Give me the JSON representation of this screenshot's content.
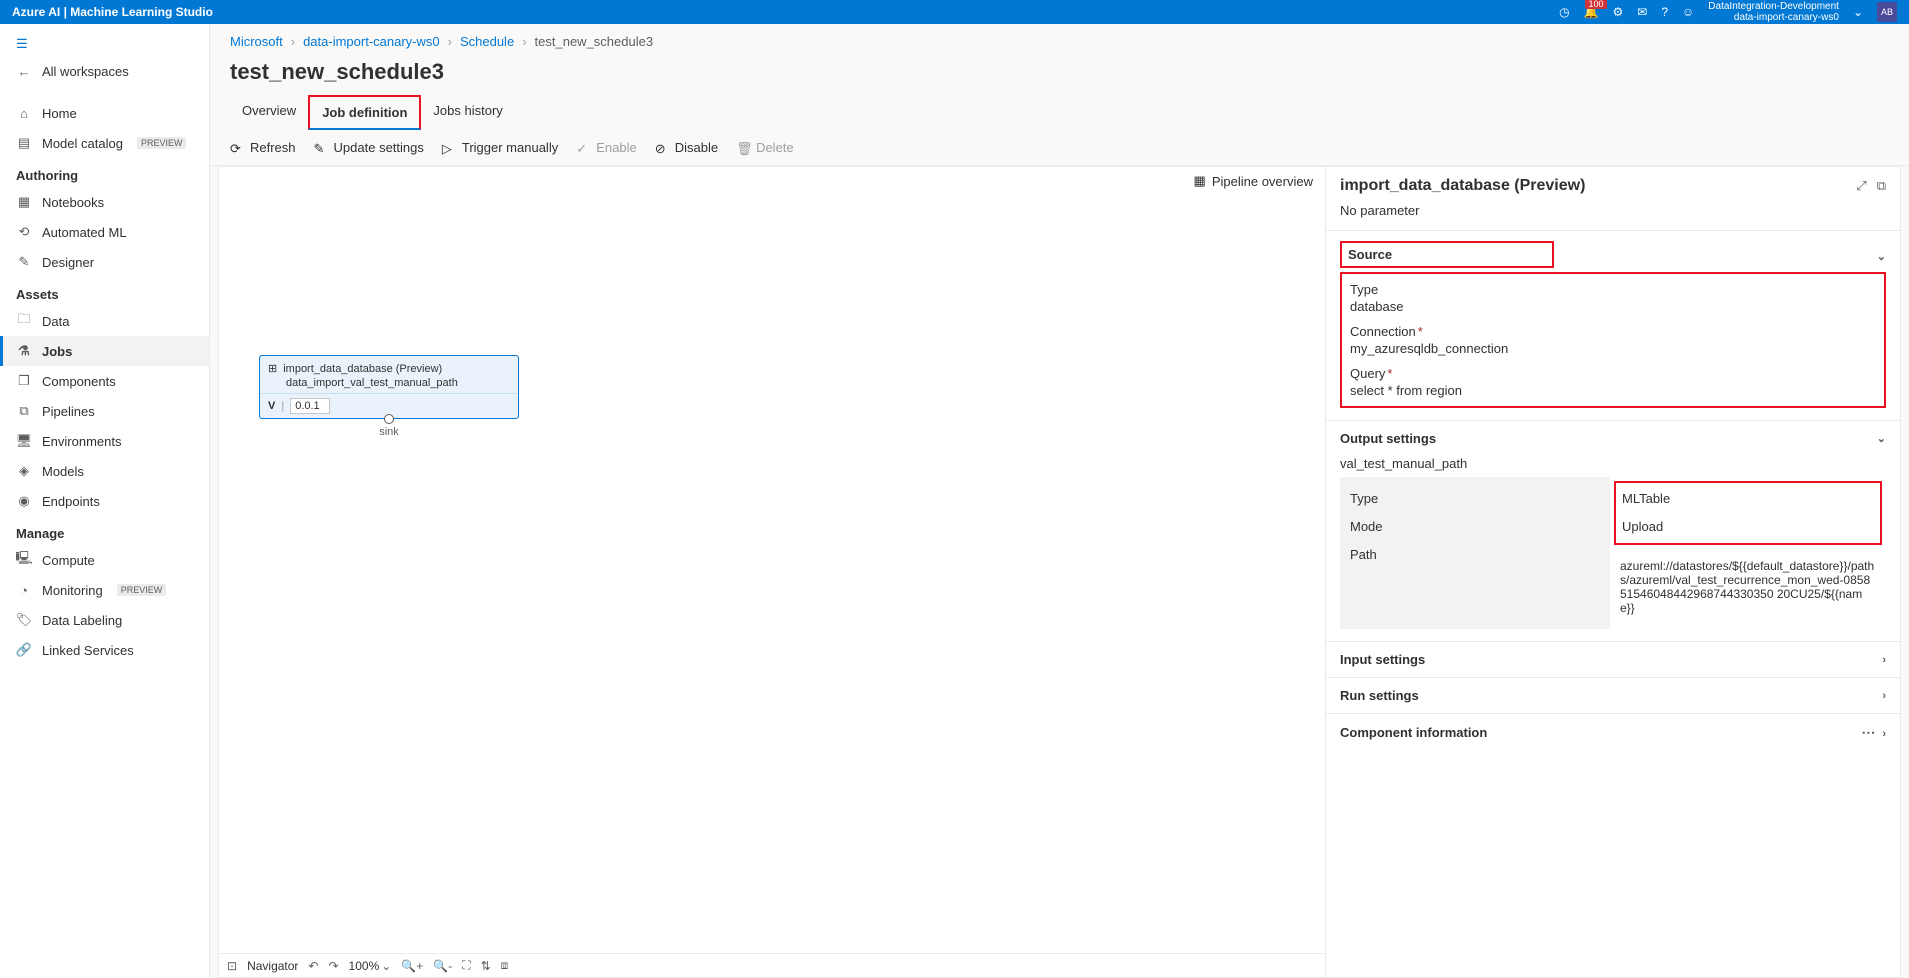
{
  "topbar": {
    "title": "Azure AI | Machine Learning Studio",
    "workspace_line1": "DataIntegration-Development",
    "workspace_line2": "data-import-canary-ws0",
    "notif_count": "100",
    "avatar": "AB"
  },
  "sidebar": {
    "all_workspaces": "All workspaces",
    "home": "Home",
    "model_catalog": "Model catalog",
    "preview": "PREVIEW",
    "authoring": "Authoring",
    "notebooks": "Notebooks",
    "automated_ml": "Automated ML",
    "designer": "Designer",
    "assets": "Assets",
    "data": "Data",
    "jobs": "Jobs",
    "components": "Components",
    "pipelines": "Pipelines",
    "environments": "Environments",
    "models": "Models",
    "endpoints": "Endpoints",
    "manage": "Manage",
    "compute": "Compute",
    "monitoring": "Monitoring",
    "data_labeling": "Data Labeling",
    "linked_services": "Linked Services"
  },
  "breadcrumbs": {
    "b0": "Microsoft",
    "b1": "data-import-canary-ws0",
    "b2": "Schedule",
    "b3": "test_new_schedule3"
  },
  "page_title": "test_new_schedule3",
  "tabs": {
    "overview": "Overview",
    "job_definition": "Job definition",
    "jobs_history": "Jobs history"
  },
  "toolbar": {
    "refresh": "Refresh",
    "update_settings": "Update settings",
    "trigger_manually": "Trigger manually",
    "enable": "Enable",
    "disable": "Disable",
    "delete": "Delete"
  },
  "canvas": {
    "pipeline_overview": "Pipeline overview",
    "node_title": "import_data_database (Preview)",
    "node_subtitle": "data_import_val_test_manual_path",
    "version_label": "V",
    "version_value": "0.0.1",
    "sink": "sink",
    "navigator": "Navigator",
    "zoom": "100%"
  },
  "details": {
    "title": "import_data_database (Preview)",
    "no_param": "No parameter",
    "source": {
      "header": "Source",
      "type_label": "Type",
      "type_value": "database",
      "connection_label": "Connection",
      "connection_value": "my_azuresqldb_connection",
      "query_label": "Query",
      "query_value": "select * from region"
    },
    "output": {
      "header": "Output settings",
      "name": "val_test_manual_path",
      "type_label": "Type",
      "type_value": "MLTable",
      "mode_label": "Mode",
      "mode_value": "Upload",
      "path_label": "Path",
      "path_value": "azureml://datastores/${{default_datastore}}/paths/azureml/val_test_recurrence_mon_wed-085851546048442968744330350 20CU25/${{name}}"
    },
    "input_settings": "Input settings",
    "run_settings": "Run settings",
    "component_info": "Component information"
  }
}
